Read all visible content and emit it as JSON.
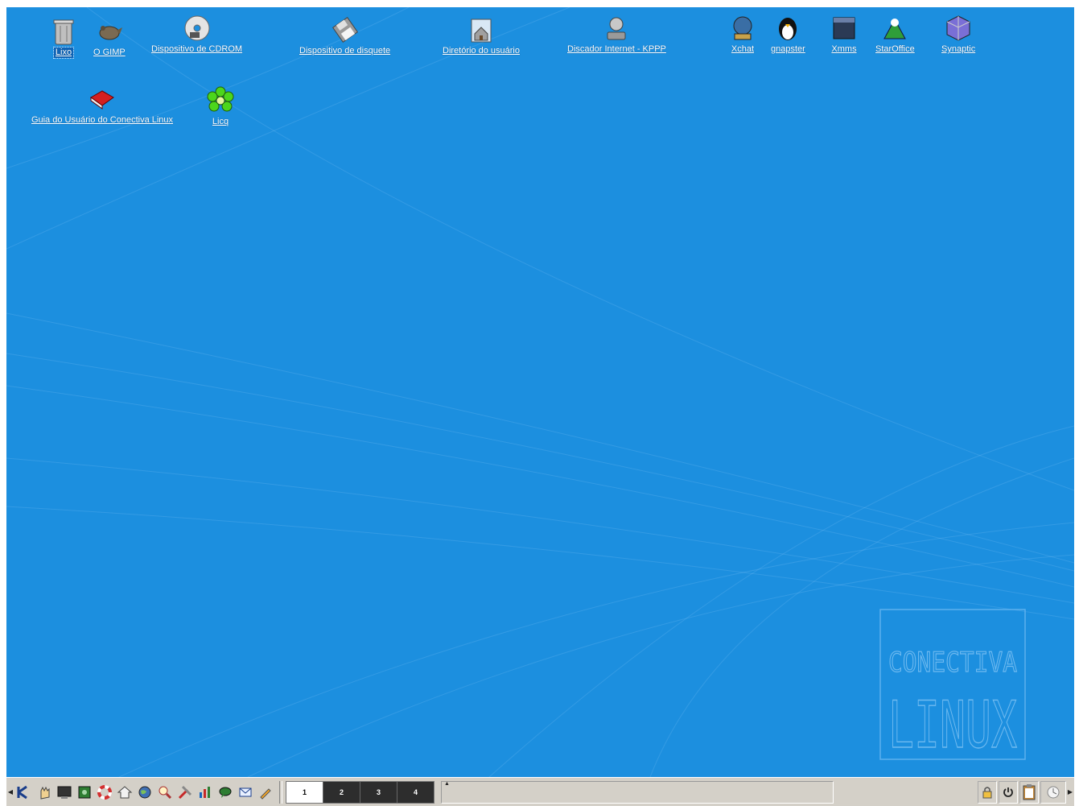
{
  "desktop": {
    "background_color": "#1c8fdf",
    "watermark": {
      "line1": "CONECTIVA",
      "line2": "LINUX"
    },
    "icons_row1": [
      {
        "label": "Lixo",
        "icon": "trash-icon",
        "selected": true
      },
      {
        "label": "O GIMP",
        "icon": "gimp-icon"
      },
      {
        "label": "Dispositivo de CDROM",
        "icon": "cdrom-icon"
      },
      {
        "label": "Dispositivo de disquete",
        "icon": "floppy-icon"
      },
      {
        "label": "Diretório do usuário",
        "icon": "home-folder-icon"
      },
      {
        "label": "Discador Internet - KPPP",
        "icon": "dialer-icon"
      },
      {
        "label": "Xchat",
        "icon": "xchat-icon"
      },
      {
        "label": "gnapster",
        "icon": "penguin-icon"
      },
      {
        "label": "Xmms",
        "icon": "xmms-icon"
      },
      {
        "label": "StarOffice",
        "icon": "staroffice-icon"
      },
      {
        "label": "Synaptic",
        "icon": "synaptic-icon"
      }
    ],
    "icons_row2": [
      {
        "label": "Guia do Usuário do Conectiva Linux",
        "icon": "book-icon"
      },
      {
        "label": "Licq",
        "icon": "licq-flower-icon"
      }
    ]
  },
  "taskbar": {
    "launchers": [
      "k-menu-icon",
      "hand-icon",
      "terminal-icon",
      "gear-box-icon",
      "lifebuoy-icon",
      "home-icon",
      "globe-icon",
      "search-icon",
      "tools-icon",
      "chart-icon",
      "chat-icon",
      "mail-icon",
      "pen-icon"
    ],
    "desktops": [
      "1",
      "2",
      "3",
      "4"
    ],
    "active_desktop": "1",
    "tray": [
      "lock-icon",
      "power-icon",
      "clipboard-icon",
      "clock-icon"
    ]
  }
}
